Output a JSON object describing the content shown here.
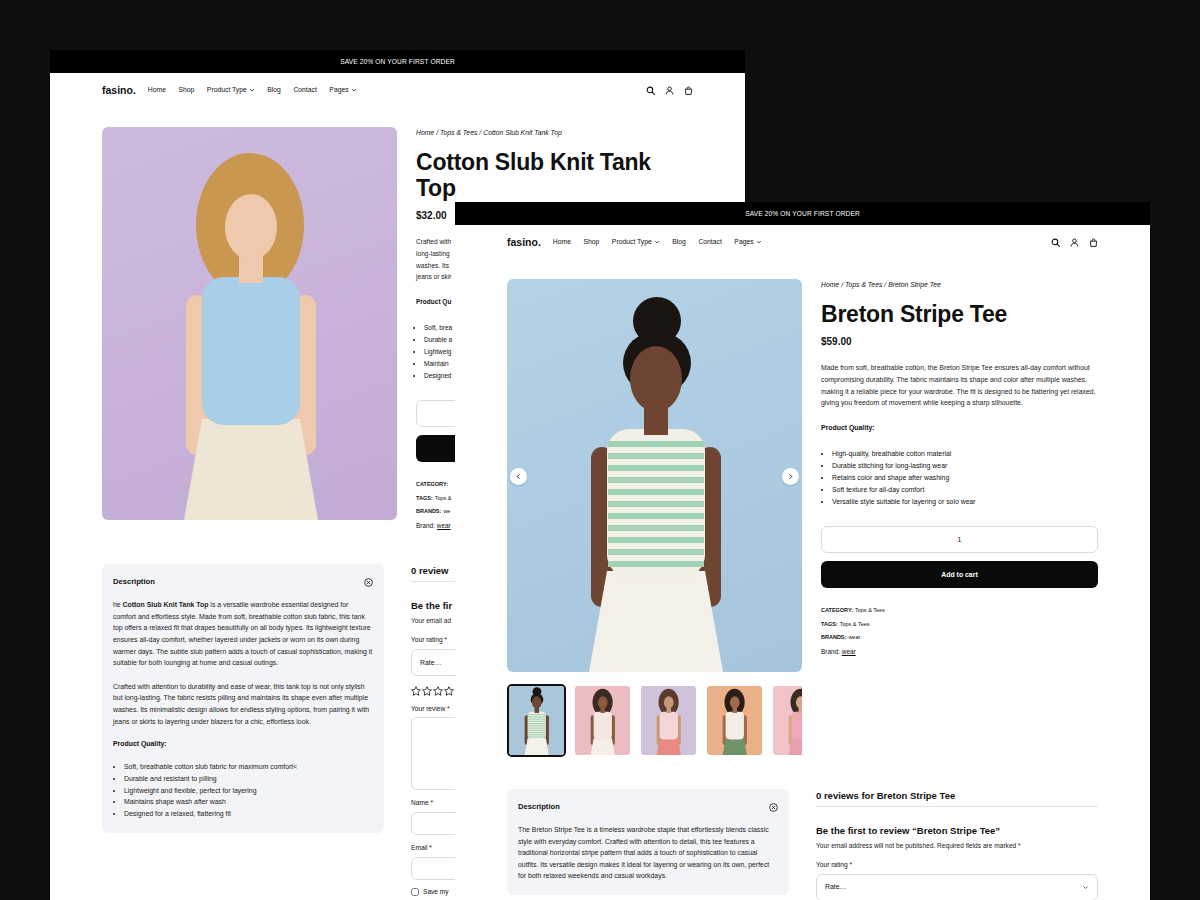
{
  "windows": [
    {
      "announcement": "SAVE 20% ON YOUR FIRST ORDER",
      "logo": "fasino.",
      "nav": [
        {
          "label": "Home",
          "kind": "link"
        },
        {
          "label": "Shop",
          "kind": "link"
        },
        {
          "label": "Product Type",
          "kind": "dropdown"
        },
        {
          "label": "Blog",
          "kind": "link"
        },
        {
          "label": "Contact",
          "kind": "link"
        },
        {
          "label": "Pages",
          "kind": "dropdown"
        }
      ],
      "breadcrumb": [
        {
          "label": "Home",
          "link": true
        },
        {
          "label": "Tops & Tees",
          "link": true
        },
        {
          "label": "Cotton Slub Knit Tank Top",
          "link": false
        }
      ],
      "breadcrumb_separator": "/",
      "title": "Cotton Slub Knit Tank Top",
      "price": "$32.00",
      "summary": [
        "Crafted with",
        "long-lasting",
        "washes. Its",
        "jeans or skir"
      ],
      "quality_heading": "Product Qu",
      "quality": [
        "Soft, brea",
        "Durable a",
        "Lightweig",
        "Maintain",
        "Designed"
      ],
      "meta": [
        {
          "label": "CATEGORY:",
          "bold": true
        },
        {
          "label": "TAGS:",
          "value": "Tops &",
          "bold": true,
          "link": false
        },
        {
          "label": "BRANDS:",
          "value": "we",
          "bold": true,
          "link": false
        },
        {
          "label": "Brand:",
          "value": "wear",
          "bold": false,
          "link": true
        }
      ],
      "description": {
        "title": "Description",
        "paragraphs": [
          [
            {
              "text": "he ",
              "bold": false
            },
            {
              "text": "Cotton Slub Knit Tank Top",
              "bold": true
            },
            {
              "text": " is a versatile wardrobe essential designed for comfort and effortless style. Made from soft, breathable cotton slub fabric, this tank top offers a relaxed fit that drapes beautifully on all body types. Its lightweight texture ensures all-day comfort, whether layered under jackets or worn on its own during warmer days. The subtle slub pattern adds a touch of casual sophistication, making it suitable for both lounging at home and casual outings.",
              "bold": false
            }
          ],
          [
            {
              "text": "Crafted with attention to durability and ease of wear, this tank top is not only stylish but long-lasting. The fabric resists pilling and maintains its shape even after multiple washes. Its minimalistic design allows for endless styling options, from pairing it with jeans or skirts to layering under blazers for a chic, effortless look.",
              "bold": false
            }
          ]
        ],
        "quality_heading": "Product Quality:",
        "quality": [
          "Soft, breathable cotton slub fabric for maximum comfort<",
          "Durable and resistant to pilling",
          "Lightweight and flexible, perfect for layering",
          "Maintains shape wash after wash",
          "Designed for a relaxed, flattering fit"
        ]
      },
      "reviews": {
        "heading": "0 review",
        "form_title": "Be the fir",
        "note": "Your email ad",
        "fields": [
          {
            "kind": "select",
            "label": "Your rating *",
            "value": "Rate…"
          },
          {
            "kind": "stars",
            "stars": 0
          },
          {
            "kind": "textarea",
            "label": "Your review *"
          },
          {
            "kind": "input",
            "label": "Name *"
          },
          {
            "kind": "input",
            "label": "Email *"
          },
          {
            "kind": "checkbox",
            "label": "Save my",
            "checked": false
          }
        ]
      }
    },
    {
      "announcement": "SAVE 20% ON YOUR FIRST ORDER",
      "logo": "fasino.",
      "nav": [
        {
          "label": "Home",
          "kind": "link"
        },
        {
          "label": "Shop",
          "kind": "link"
        },
        {
          "label": "Product Type",
          "kind": "dropdown"
        },
        {
          "label": "Blog",
          "kind": "link"
        },
        {
          "label": "Contact",
          "kind": "link"
        },
        {
          "label": "Pages",
          "kind": "dropdown"
        }
      ],
      "thumbnails": [
        {
          "selected": true
        },
        {
          "selected": false
        },
        {
          "selected": false
        },
        {
          "selected": false
        },
        {
          "selected": false
        }
      ],
      "breadcrumb": [
        {
          "label": "Home",
          "link": true
        },
        {
          "label": "Tops & Tees",
          "link": true
        },
        {
          "label": "Breton Stripe Tee",
          "link": false
        }
      ],
      "breadcrumb_separator": "/",
      "title": "Breton Stripe Tee",
      "price": "$59.00",
      "summary": [
        "Made from soft, breathable cotton, the Breton Stripe Tee ensures all-day comfort without compromising durability. The fabric maintains its shape and color after multiple washes, making it a reliable piece for your wardrobe. The fit is designed to be flattering yet relaxed, giving you freedom of movement while keeping a sharp silhouette."
      ],
      "quality_heading": "Product Quality:",
      "quality": [
        "High-quality, breathable cotton material",
        "Durable stitching for long-lasting wear",
        "Retains color and shape after washing",
        "Soft texture for all-day comfort",
        "Versatile style suitable for layering or solo wear"
      ],
      "quantity": "1",
      "add_to_cart": "Add to cart",
      "meta": [
        {
          "label": "CATEGORY:",
          "value": "Tops & Tees",
          "bold": true,
          "link": false
        },
        {
          "label": "TAGS:",
          "value": "Tops & Tees",
          "bold": true,
          "link": false
        },
        {
          "label": "BRANDS:",
          "value": "wear",
          "bold": true,
          "link": false
        },
        {
          "label": "Brand:",
          "value": "wear",
          "bold": false,
          "link": true
        }
      ],
      "description": {
        "title": "Description",
        "paragraphs": [
          [
            {
              "text": "The Breton Stripe Tee is a timeless wardrobe staple that effortlessly blends classic style with everyday comfort. Crafted with attention to detail, this tee features a traditional horizontal stripe pattern that adds a touch of sophistication to casual outfits. Its versatile design makes it ideal for layering or wearing on its own, perfect for both relaxed weekends and casual workdays.",
              "bold": false
            }
          ]
        ]
      },
      "reviews": {
        "heading": "0 reviews for Breton Stripe Tee",
        "form_title": "Be the first to review “Breton Stripe Tee”",
        "note": "Your email address will not be published. Required fields are marked *",
        "fields": [
          {
            "kind": "select",
            "label": "Your rating *",
            "value": "Rate…"
          }
        ]
      }
    }
  ]
}
